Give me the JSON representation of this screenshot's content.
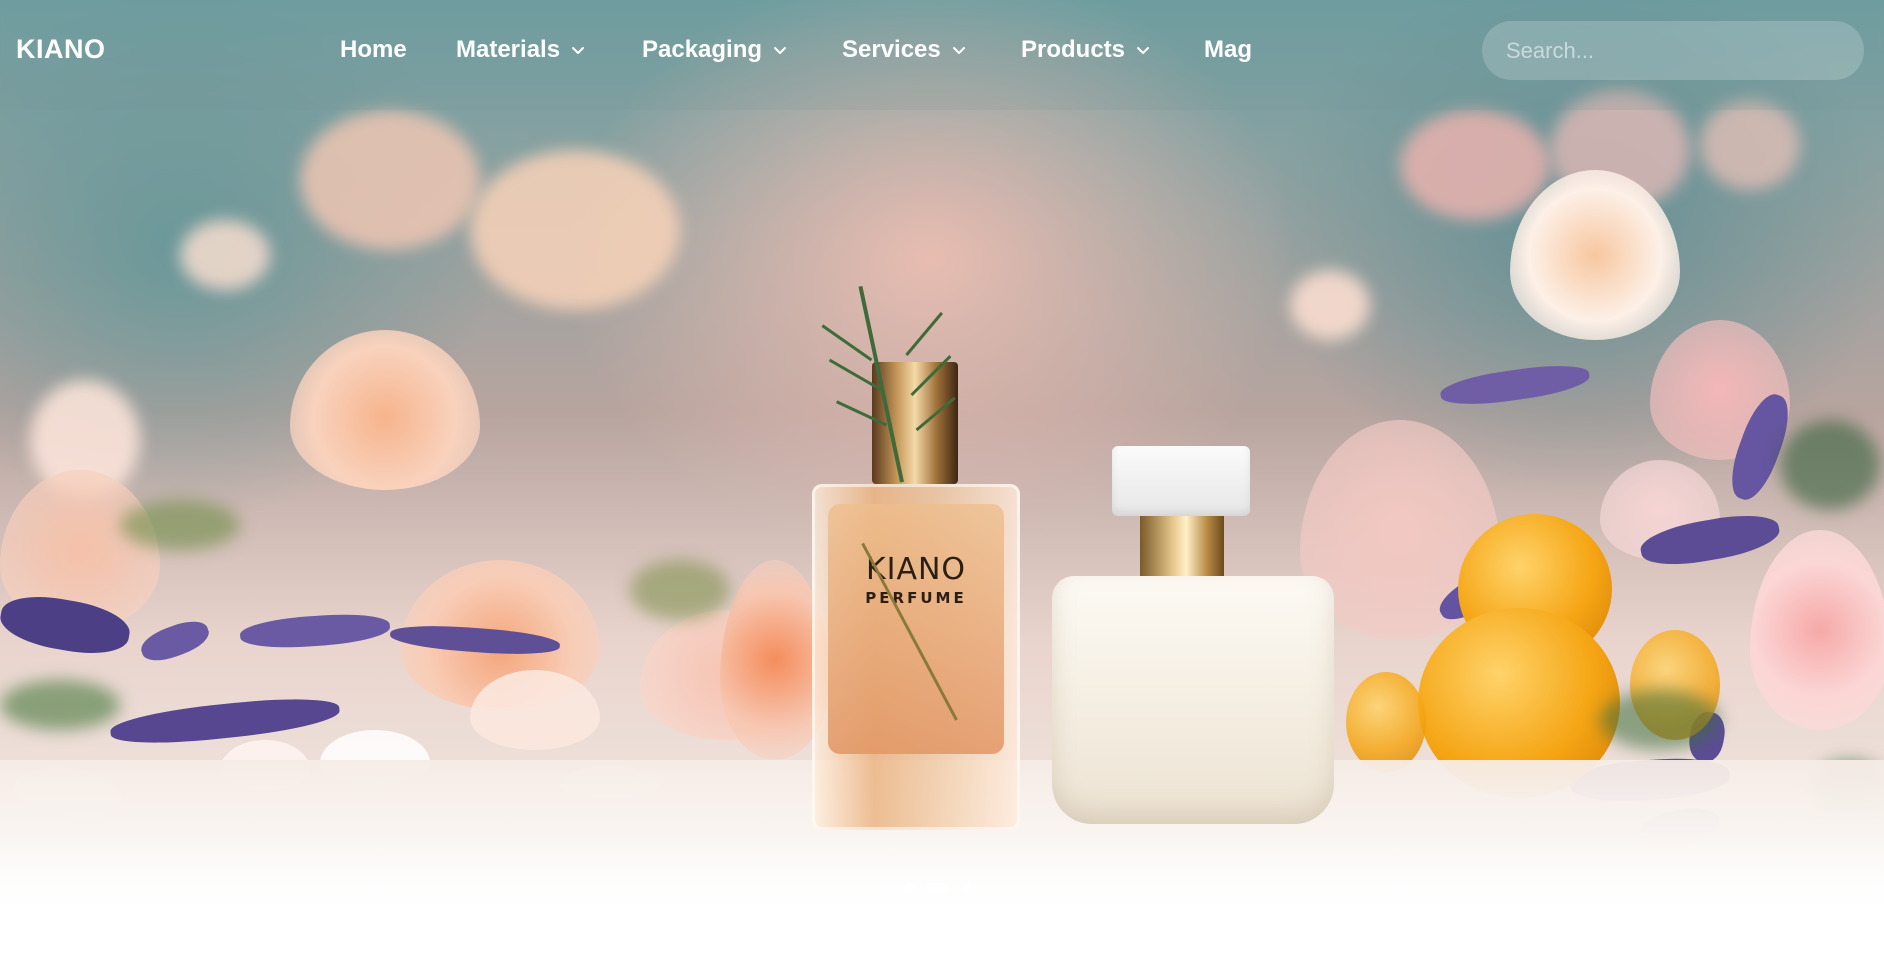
{
  "brand": {
    "logo_text": "KIANO"
  },
  "nav": {
    "items": [
      {
        "label": "Home",
        "has_dropdown": false
      },
      {
        "label": "Materials",
        "has_dropdown": true
      },
      {
        "label": "Packaging",
        "has_dropdown": true
      },
      {
        "label": "Services",
        "has_dropdown": true
      },
      {
        "label": "Products",
        "has_dropdown": true
      },
      {
        "label": "Mag",
        "has_dropdown": false
      }
    ]
  },
  "search": {
    "placeholder": "Search...",
    "value": ""
  },
  "hero": {
    "bottle_label_brand": "KIANO",
    "bottle_label_sub": "PERFUME",
    "slides_total": 3,
    "active_slide": 2
  },
  "colors": {
    "nav_text": "#ffffff",
    "accent_gold": "#c89a5c",
    "background_teal": "#6c9fa2",
    "background_pink": "#ecbeb2"
  },
  "icons": {
    "dropdown": "chevron-down-icon"
  }
}
